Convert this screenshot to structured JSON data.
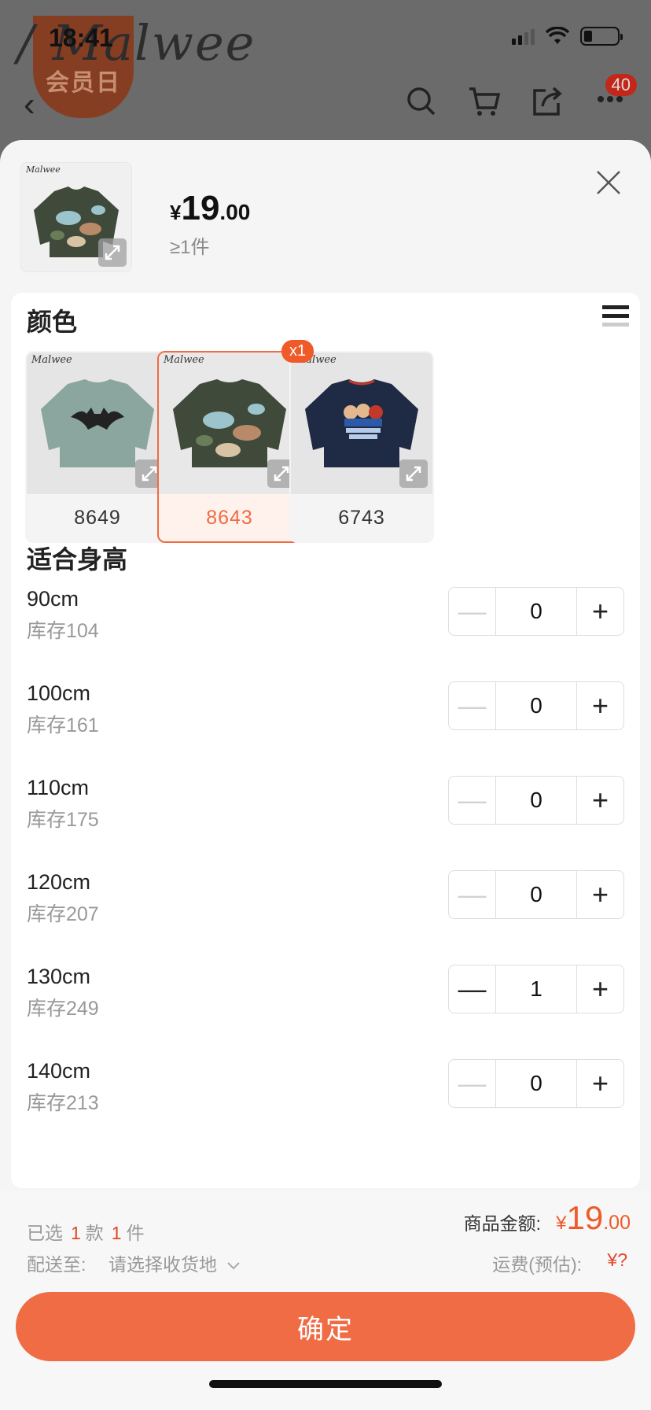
{
  "background": {
    "logo": "/ Malwee",
    "badge": "会员日",
    "cart_count": "40"
  },
  "status_bar": {
    "time": "18:41"
  },
  "header": {
    "price_yen": "¥",
    "price_int": "19",
    "price_dec": ".00",
    "min_qty": "≥1件",
    "thumb_brand": "Malwee"
  },
  "color_section": {
    "title": "颜色",
    "items": [
      {
        "code": "8649",
        "brand": "Malwee",
        "selected": false,
        "badge": ""
      },
      {
        "code": "8643",
        "brand": "Malwee",
        "selected": true,
        "badge": "x1"
      },
      {
        "code": "6743",
        "brand": "Malwee",
        "selected": false,
        "badge": ""
      }
    ]
  },
  "size_section": {
    "title": "适合身高",
    "rows": [
      {
        "size": "90cm",
        "stock": "库存104",
        "qty": "0"
      },
      {
        "size": "100cm",
        "stock": "库存161",
        "qty": "0"
      },
      {
        "size": "110cm",
        "stock": "库存175",
        "qty": "0"
      },
      {
        "size": "120cm",
        "stock": "库存207",
        "qty": "0"
      },
      {
        "size": "130cm",
        "stock": "库存249",
        "qty": "1"
      },
      {
        "size": "140cm",
        "stock": "库存213",
        "qty": "0"
      }
    ]
  },
  "footer": {
    "selected_prefix": "已选",
    "selected_styles": "1",
    "styles_unit": "款",
    "selected_items": "1",
    "items_unit": "件",
    "total_label": "商品金额:",
    "total_yen": "¥",
    "total_int": "19",
    "total_dec": ".00",
    "ship_label": "配送至:",
    "ship_value": "请选择收货地",
    "ship_fee_label": "运费(预估):",
    "ship_fee": "¥?",
    "confirm_label": "确定"
  },
  "colors": {
    "accent": "#ef6c44",
    "price": "#ef5a28",
    "highlight": "#e2482a"
  }
}
